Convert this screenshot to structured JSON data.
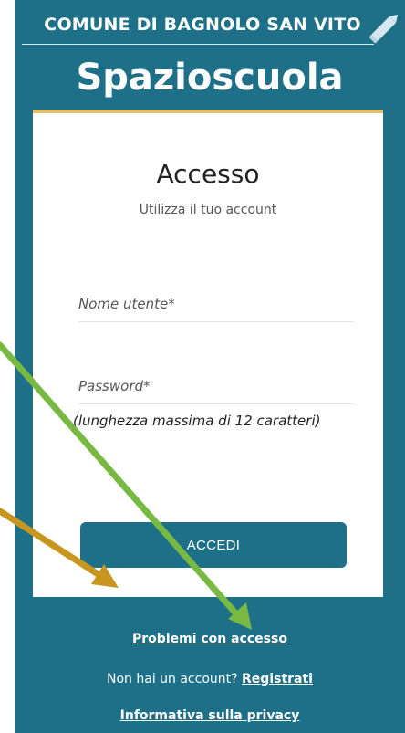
{
  "header": {
    "municipality": "COMUNE DI BAGNOLO SAN VITO",
    "brand": "Spazioscuola",
    "icon": "pencil-icon"
  },
  "login": {
    "title": "Accesso",
    "subtitle": "Utilizza il tuo account",
    "username_placeholder": "Nome utente*",
    "password_placeholder": "Password*",
    "password_hint": "(lunghezza massima di 12 caratteri)",
    "submit_label": "ACCEDI"
  },
  "footer": {
    "problems_link": "Problemi con accesso",
    "no_account_text": "Non hai un account?",
    "register_link": "Registrati",
    "privacy_link": "Informativa sulla privacy"
  },
  "colors": {
    "panel_bg": "#1d7088",
    "card_top_border": "#e1c26a",
    "arrow_green": "#78b943",
    "arrow_gold": "#c8961e"
  }
}
